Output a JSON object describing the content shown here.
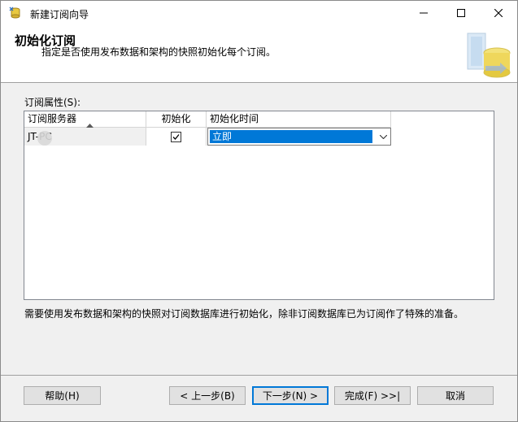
{
  "window": {
    "title": "新建订阅向导"
  },
  "header": {
    "title": "初始化订阅",
    "description": "指定是否使用发布数据和架构的快照初始化每个订阅。"
  },
  "properties": {
    "label": "订阅属性(S):",
    "columns": {
      "server": "订阅服务器",
      "initialize": "初始化",
      "time": "初始化时间"
    },
    "rows": [
      {
        "server": "JT-PC",
        "initialize": true,
        "time": "立即"
      }
    ]
  },
  "note": "需要使用发布数据和架构的快照对订阅数据库进行初始化，除非订阅数据库已为订阅作了特殊的准备。",
  "buttons": {
    "help": "帮助(H)",
    "prev": "< 上一步(B)",
    "next": "下一步(N) >",
    "finish": "完成(F) >>|",
    "cancel": "取消"
  },
  "colors": {
    "selection": "#0078d7",
    "accent": "#0078d7"
  }
}
